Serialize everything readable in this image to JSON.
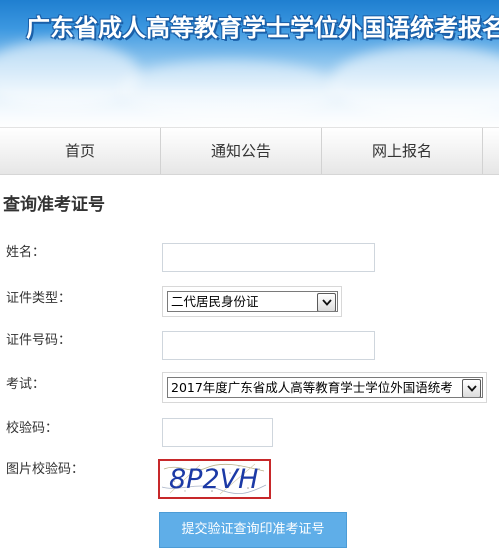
{
  "header": {
    "site_title": "广东省成人高等教育学士学位外国语统考报名"
  },
  "nav": {
    "items": [
      {
        "label": "首页"
      },
      {
        "label": "通知公告"
      },
      {
        "label": "网上报名"
      }
    ]
  },
  "form": {
    "section_title": "查询准考证号",
    "name": {
      "label": "姓名：",
      "value": ""
    },
    "id_type": {
      "label": "证件类型：",
      "selected": "二代居民身份证"
    },
    "id_number": {
      "label": "证件号码：",
      "value": ""
    },
    "exam": {
      "label": "考试：",
      "selected": "2017年度广东省成人高等教育学士学位外国语统考"
    },
    "check_code": {
      "label": "校验码：",
      "value": ""
    },
    "image_code": {
      "label": "图片校验码：",
      "captcha_text": "8P2VH"
    },
    "submit_label": "提交验证查询印准考证号"
  },
  "colors": {
    "banner_blue": "#1f7fd0",
    "button_blue": "#5faee8",
    "captcha_border": "#c7282a",
    "captcha_text": "#1c3aa6"
  },
  "icons": {
    "dropdown": "chevron-down-icon"
  }
}
